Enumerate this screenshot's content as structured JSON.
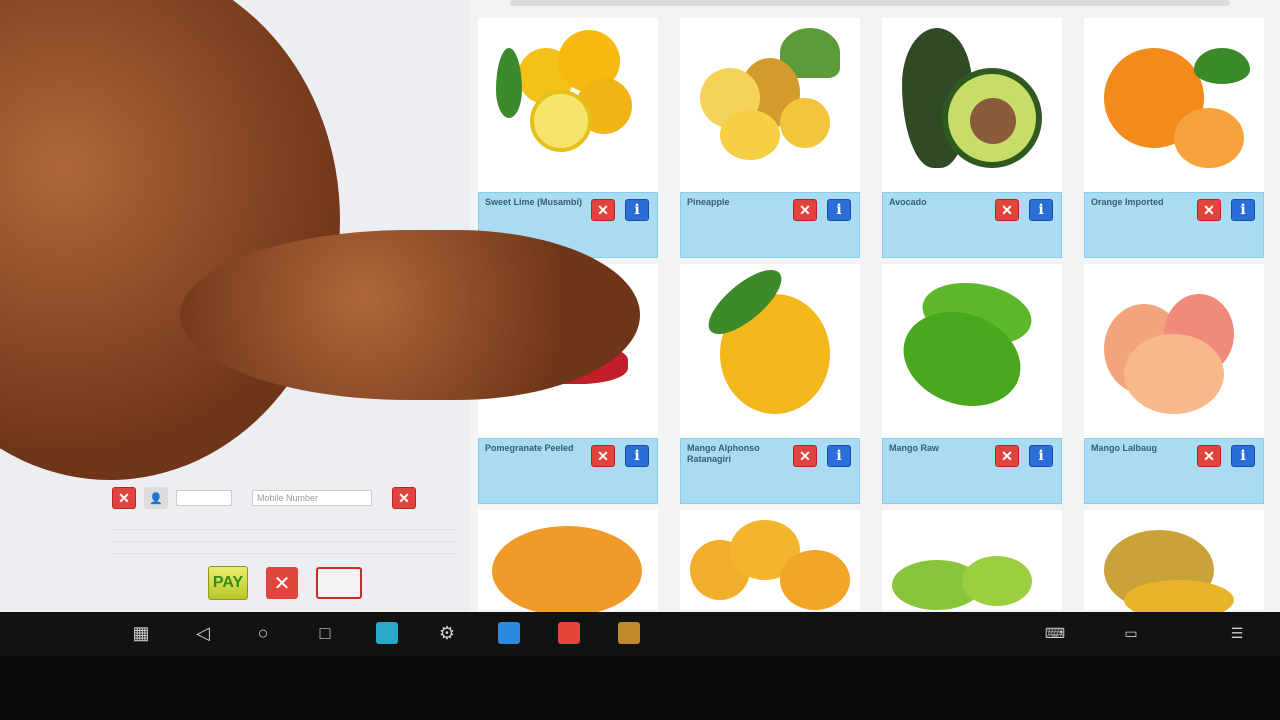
{
  "products": [
    {
      "name": "Sweet Lime (Musambi)",
      "line1": "",
      "line2": ""
    },
    {
      "name": "Pineapple",
      "line1": "",
      "line2": ""
    },
    {
      "name": "Avocado",
      "line1": "",
      "line2": ""
    },
    {
      "name": "Orange Imported",
      "line1": "",
      "line2": ""
    },
    {
      "name": "Pomegranate Peeled",
      "line1": "",
      "line2": ""
    },
    {
      "name": "Mango Alphonso Ratanagiri",
      "line1": "",
      "line2": ""
    },
    {
      "name": "Mango Raw",
      "line1": "",
      "line2": ""
    },
    {
      "name": "Mango Lalbaug",
      "line1": "",
      "line2": ""
    }
  ],
  "cart": {
    "mobile_placeholder": "Mobile Number",
    "pay_label": "PAY"
  },
  "icons": {
    "remove": "close-icon",
    "info": "info-icon"
  },
  "colors": {
    "caption_bg": "#a9dcf3",
    "remove_btn": "#e0443c",
    "info_btn": "#2a6fd8",
    "pay_btn": "#d6e04a"
  }
}
